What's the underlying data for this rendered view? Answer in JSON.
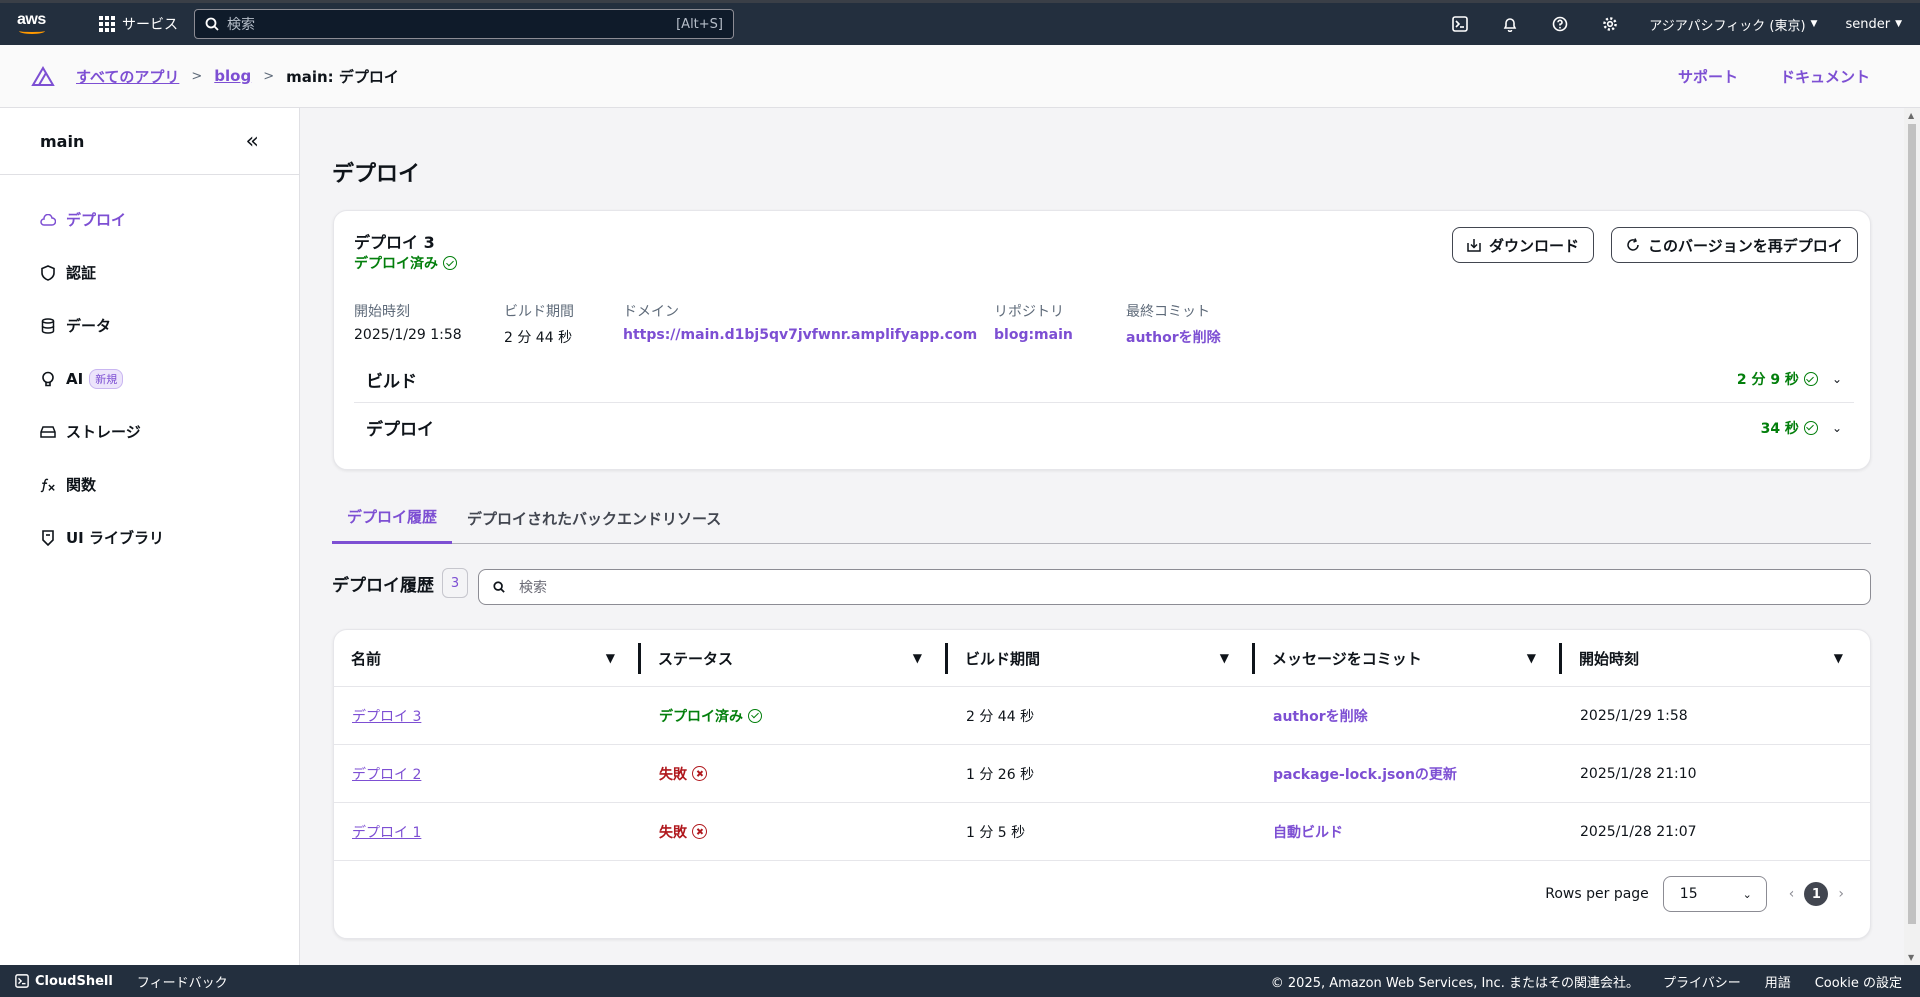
{
  "topnav": {
    "logo_text": "aws",
    "services_label": "サービス",
    "search_placeholder": "検索",
    "search_shortcut": "[Alt+S]",
    "region": "アジアパシフィック (東京)",
    "account": "sender"
  },
  "breadcrumb": {
    "items": [
      "すべてのアプリ",
      "blog"
    ],
    "current": "main: デプロイ",
    "support": "サポート",
    "docs": "ドキュメント"
  },
  "sidebar": {
    "title": "main",
    "items": [
      {
        "label": "デプロイ",
        "icon": "cloud-icon"
      },
      {
        "label": "認証",
        "icon": "shield-icon"
      },
      {
        "label": "データ",
        "icon": "database-icon"
      },
      {
        "label": "AI",
        "icon": "brain-icon",
        "badge": "新規"
      },
      {
        "label": "ストレージ",
        "icon": "storage-icon"
      },
      {
        "label": "関数",
        "icon": "function-icon"
      },
      {
        "label": "UI ライブラリ",
        "icon": "ui-library-icon"
      }
    ]
  },
  "page": {
    "title": "デプロイ"
  },
  "deploy": {
    "name": "デプロイ 3",
    "status": "デプロイ済み",
    "download_label": "ダウンロード",
    "redeploy_label": "このバージョンを再デプロイ",
    "meta": [
      {
        "label": "開始時刻",
        "value": "2025/1/29 1:58"
      },
      {
        "label": "ビルド期間",
        "value": "2 分 44 秒"
      },
      {
        "label": "ドメイン",
        "value": "https://main.d1bj5qv7jvfwnr.amplifyapp.com"
      },
      {
        "label": "リポジトリ",
        "value": "blog:main"
      },
      {
        "label": "最終コミット",
        "value": "authorを削除"
      }
    ],
    "sections": [
      {
        "title": "ビルド",
        "time": "2 分 9 秒"
      },
      {
        "title": "デプロイ",
        "time": "34 秒"
      }
    ]
  },
  "tabs": [
    "デプロイ履歴",
    "デプロイされたバックエンドリソース"
  ],
  "history": {
    "title": "デプロイ履歴",
    "count": "3",
    "search_placeholder": "検索",
    "columns": [
      "名前",
      "ステータス",
      "ビルド期間",
      "メッセージをコミット",
      "開始時刻"
    ],
    "rows": [
      {
        "name": "デプロイ 3",
        "status": "デプロイ済み",
        "duration": "2 分 44 秒",
        "message": "authorを削除",
        "start": "2025/1/29 1:58"
      },
      {
        "name": "デプロイ 2",
        "status": "失敗",
        "duration": "1 分 26 秒",
        "message": "package-lock.jsonの更新",
        "start": "2025/1/28 21:10"
      },
      {
        "name": "デプロイ 1",
        "status": "失敗",
        "duration": "1 分 5 秒",
        "message": "自動ビルド",
        "start": "2025/1/28 21:07"
      }
    ],
    "rows_per_page_label": "Rows per page",
    "rows_per_page": "15",
    "page": "1"
  },
  "footer": {
    "cloudshell": "CloudShell",
    "feedback": "フィードバック",
    "copyright": "© 2025, Amazon Web Services, Inc. またはその関連会社。",
    "privacy": "プライバシー",
    "terms": "用語",
    "cookies": "Cookie の設定"
  },
  "colors": {
    "accent": "#7d4fd3",
    "success": "#037f0c",
    "error": "#b0181d",
    "nav_bg": "#232f3e"
  }
}
